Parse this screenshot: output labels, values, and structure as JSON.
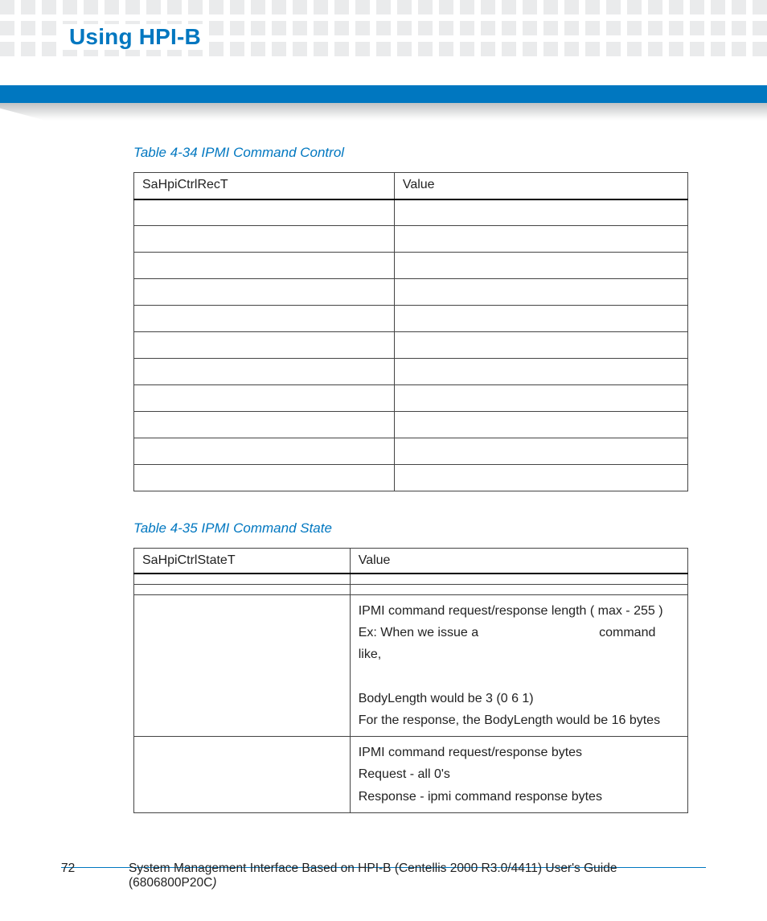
{
  "header": {
    "title": "Using HPI-B"
  },
  "table1": {
    "caption": "Table 4-34  IPMI Command Control",
    "head_left": "SaHpiCtrlRecT",
    "head_right": "Value",
    "rows": [
      {
        "l": "",
        "r": ""
      },
      {
        "l": "",
        "r": ""
      },
      {
        "l": "",
        "r": ""
      },
      {
        "l": "",
        "r": ""
      },
      {
        "l": "",
        "r": ""
      },
      {
        "l": "",
        "r": ""
      },
      {
        "l": "",
        "r": ""
      },
      {
        "l": "",
        "r": ""
      },
      {
        "l": "",
        "r": ""
      },
      {
        "l": "",
        "r": ""
      },
      {
        "l": "",
        "r": ""
      }
    ]
  },
  "table2": {
    "caption": "Table 4-35 IPMI Command State",
    "head_left": "SaHpiCtrlStateT",
    "head_right": "Value",
    "rows": [
      {
        "l": "",
        "r": ""
      },
      {
        "l": "",
        "r": ""
      }
    ],
    "row3": {
      "r1": "IPMI command request/response length ( max - 255 )",
      "r2a": "Ex: When we issue a",
      "r2b": "command like,",
      "r3": "BodyLength would be 3 (0 6 1)",
      "r4": "For the response, the BodyLength would be 16 bytes"
    },
    "row4": {
      "r1": "IPMI command request/response bytes",
      "r2": "Request - all 0's",
      "r3": "Response - ipmi command response bytes"
    }
  },
  "footer": {
    "page": "72",
    "text_prefix": "System Management Interface Based on HPI-B (Centellis 2000 R3.0/4411) User's Guide (6806800P20C",
    "text_suffix": ")"
  }
}
